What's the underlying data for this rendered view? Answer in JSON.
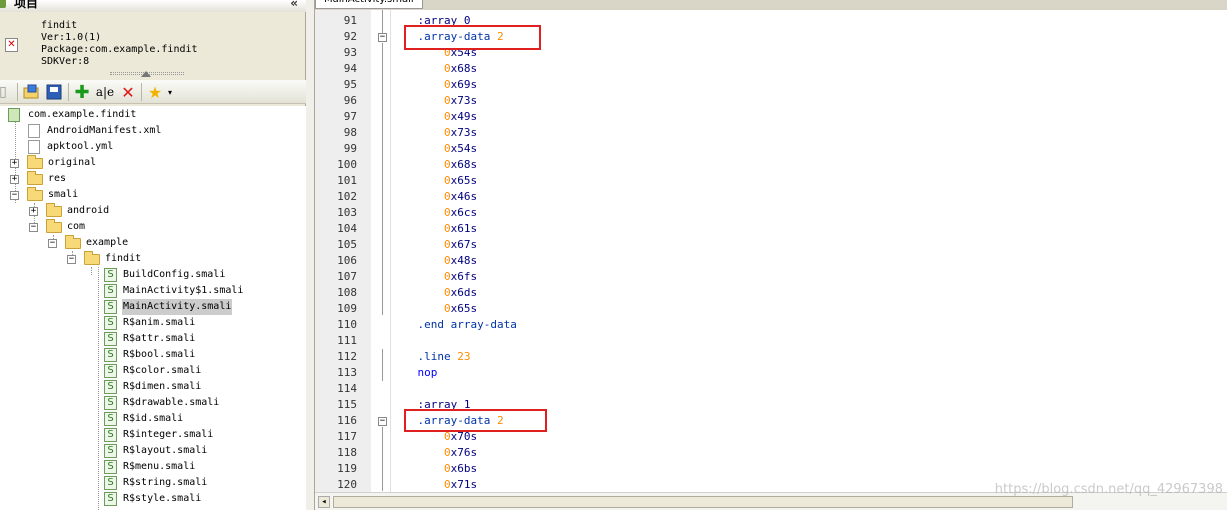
{
  "left_panel": {
    "title": "项目",
    "collapse_glyph": "«",
    "app_info": {
      "name": "findit",
      "version": "Ver:1.0(1)",
      "package": "Package:com.example.findit",
      "sdk": "SDKVer:8"
    },
    "toolbar_icons": [
      "open-folder-icon",
      "save-icon",
      "add-icon",
      "rename-icon",
      "delete-icon",
      "favorite-icon"
    ]
  },
  "tree": [
    {
      "label": "com.example.findit",
      "type": "package"
    },
    {
      "label": "AndroidManifest.xml",
      "type": "file"
    },
    {
      "label": "apktool.yml",
      "type": "file"
    },
    {
      "label": "original",
      "type": "folder",
      "expander": "+"
    },
    {
      "label": "res",
      "type": "folder",
      "expander": "+"
    },
    {
      "label": "smali",
      "type": "folder",
      "expander": "-"
    },
    {
      "label": "android",
      "type": "folder",
      "expander": "+"
    },
    {
      "label": "com",
      "type": "folder",
      "expander": "-"
    },
    {
      "label": "example",
      "type": "folder",
      "expander": "-"
    },
    {
      "label": "findit",
      "type": "folder",
      "expander": "-"
    },
    {
      "label": "BuildConfig.smali",
      "type": "smali"
    },
    {
      "label": "MainActivity$1.smali",
      "type": "smali"
    },
    {
      "label": "MainActivity.smali",
      "type": "smali",
      "selected": true
    },
    {
      "label": "R$anim.smali",
      "type": "smali"
    },
    {
      "label": "R$attr.smali",
      "type": "smali"
    },
    {
      "label": "R$bool.smali",
      "type": "smali"
    },
    {
      "label": "R$color.smali",
      "type": "smali"
    },
    {
      "label": "R$dimen.smali",
      "type": "smali"
    },
    {
      "label": "R$drawable.smali",
      "type": "smali"
    },
    {
      "label": "R$id.smali",
      "type": "smali"
    },
    {
      "label": "R$integer.smali",
      "type": "smali"
    },
    {
      "label": "R$layout.smali",
      "type": "smali"
    },
    {
      "label": "R$menu.smali",
      "type": "smali"
    },
    {
      "label": "R$string.smali",
      "type": "smali"
    },
    {
      "label": "R$style.smali",
      "type": "smali"
    }
  ],
  "editor": {
    "tab_label": "MainActivity.smali",
    "lines": [
      {
        "n": "91",
        "parts": [
          [
            "k-label",
            "    :array_0"
          ]
        ]
      },
      {
        "n": "92",
        "parts": [
          [
            "k-dir",
            "    .array-data "
          ],
          [
            "k-num",
            "2"
          ]
        ],
        "fold": "-"
      },
      {
        "n": "93",
        "parts": [
          [
            "",
            "        "
          ],
          [
            "k-zero",
            "0"
          ],
          [
            "k-hexx",
            "x54s"
          ]
        ]
      },
      {
        "n": "94",
        "parts": [
          [
            "",
            "        "
          ],
          [
            "k-zero",
            "0"
          ],
          [
            "k-hexx",
            "x68s"
          ]
        ]
      },
      {
        "n": "95",
        "parts": [
          [
            "",
            "        "
          ],
          [
            "k-zero",
            "0"
          ],
          [
            "k-hexx",
            "x69s"
          ]
        ]
      },
      {
        "n": "96",
        "parts": [
          [
            "",
            "        "
          ],
          [
            "k-zero",
            "0"
          ],
          [
            "k-hexx",
            "x73s"
          ]
        ]
      },
      {
        "n": "97",
        "parts": [
          [
            "",
            "        "
          ],
          [
            "k-zero",
            "0"
          ],
          [
            "k-hexx",
            "x49s"
          ]
        ]
      },
      {
        "n": "98",
        "parts": [
          [
            "",
            "        "
          ],
          [
            "k-zero",
            "0"
          ],
          [
            "k-hexx",
            "x73s"
          ]
        ]
      },
      {
        "n": "99",
        "parts": [
          [
            "",
            "        "
          ],
          [
            "k-zero",
            "0"
          ],
          [
            "k-hexx",
            "x54s"
          ]
        ]
      },
      {
        "n": "100",
        "parts": [
          [
            "",
            "        "
          ],
          [
            "k-zero",
            "0"
          ],
          [
            "k-hexx",
            "x68s"
          ]
        ]
      },
      {
        "n": "101",
        "parts": [
          [
            "",
            "        "
          ],
          [
            "k-zero",
            "0"
          ],
          [
            "k-hexx",
            "x65s"
          ]
        ]
      },
      {
        "n": "102",
        "parts": [
          [
            "",
            "        "
          ],
          [
            "k-zero",
            "0"
          ],
          [
            "k-hexx",
            "x46s"
          ]
        ]
      },
      {
        "n": "103",
        "parts": [
          [
            "",
            "        "
          ],
          [
            "k-zero",
            "0"
          ],
          [
            "k-hexx",
            "x6cs"
          ]
        ]
      },
      {
        "n": "104",
        "parts": [
          [
            "",
            "        "
          ],
          [
            "k-zero",
            "0"
          ],
          [
            "k-hexx",
            "x61s"
          ]
        ]
      },
      {
        "n": "105",
        "parts": [
          [
            "",
            "        "
          ],
          [
            "k-zero",
            "0"
          ],
          [
            "k-hexx",
            "x67s"
          ]
        ]
      },
      {
        "n": "106",
        "parts": [
          [
            "",
            "        "
          ],
          [
            "k-zero",
            "0"
          ],
          [
            "k-hexx",
            "x48s"
          ]
        ]
      },
      {
        "n": "107",
        "parts": [
          [
            "",
            "        "
          ],
          [
            "k-zero",
            "0"
          ],
          [
            "k-hexx",
            "x6fs"
          ]
        ]
      },
      {
        "n": "108",
        "parts": [
          [
            "",
            "        "
          ],
          [
            "k-zero",
            "0"
          ],
          [
            "k-hexx",
            "x6ds"
          ]
        ]
      },
      {
        "n": "109",
        "parts": [
          [
            "",
            "        "
          ],
          [
            "k-zero",
            "0"
          ],
          [
            "k-hexx",
            "x65s"
          ]
        ]
      },
      {
        "n": "110",
        "parts": [
          [
            "k-dir",
            "    .end array-data"
          ]
        ]
      },
      {
        "n": "111",
        "parts": []
      },
      {
        "n": "112",
        "parts": [
          [
            "k-dir",
            "    .line "
          ],
          [
            "k-num",
            "23"
          ]
        ]
      },
      {
        "n": "113",
        "parts": [
          [
            "k-kw",
            "    nop"
          ]
        ]
      },
      {
        "n": "114",
        "parts": []
      },
      {
        "n": "115",
        "parts": [
          [
            "k-label",
            "    :array_1"
          ]
        ]
      },
      {
        "n": "116",
        "parts": [
          [
            "k-dir",
            "    .array-data "
          ],
          [
            "k-num",
            "2"
          ]
        ],
        "fold": "-"
      },
      {
        "n": "117",
        "parts": [
          [
            "",
            "        "
          ],
          [
            "k-zero",
            "0"
          ],
          [
            "k-hexx",
            "x70s"
          ]
        ]
      },
      {
        "n": "118",
        "parts": [
          [
            "",
            "        "
          ],
          [
            "k-zero",
            "0"
          ],
          [
            "k-hexx",
            "x76s"
          ]
        ]
      },
      {
        "n": "119",
        "parts": [
          [
            "",
            "        "
          ],
          [
            "k-zero",
            "0"
          ],
          [
            "k-hexx",
            "x6bs"
          ]
        ]
      },
      {
        "n": "120",
        "parts": [
          [
            "",
            "        "
          ],
          [
            "k-zero",
            "0"
          ],
          [
            "k-hexx",
            "x71s"
          ]
        ]
      }
    ]
  },
  "watermark": "https://blog.csdn.net/qq_42967398"
}
